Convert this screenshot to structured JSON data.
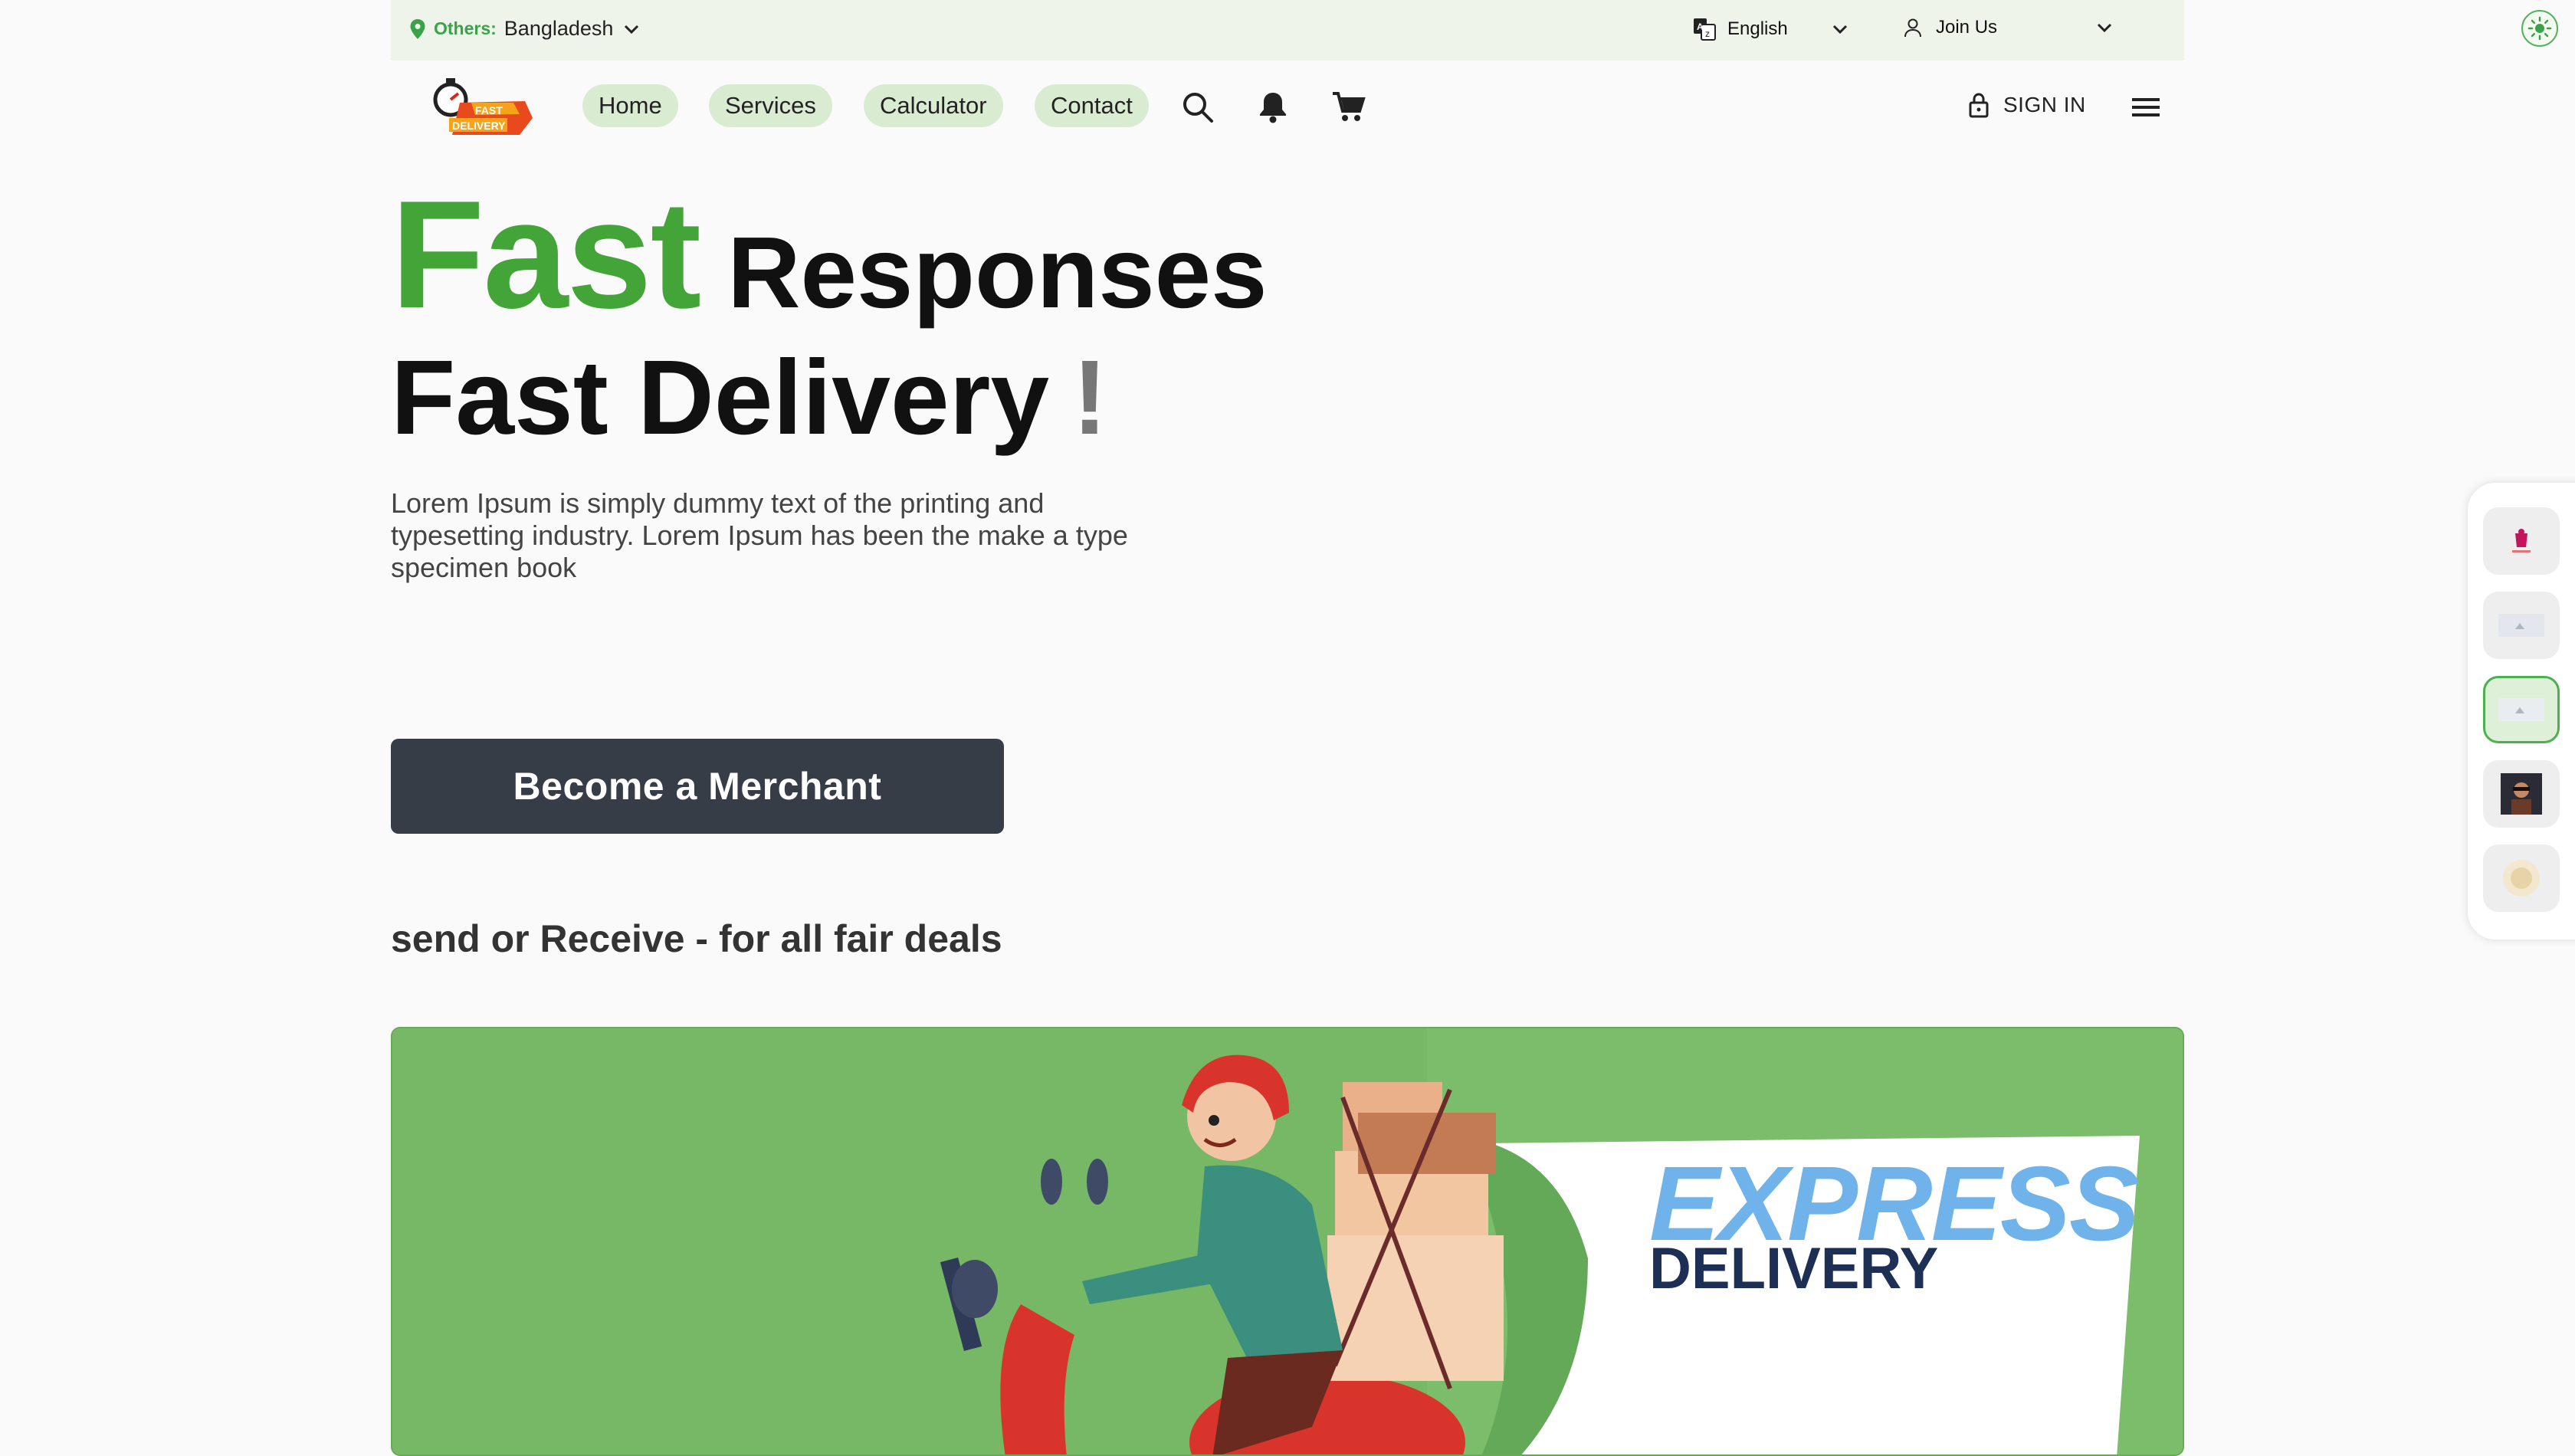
{
  "topbar": {
    "location_label": "Others:",
    "location_value": "Bangladesh",
    "language": "English",
    "join_label": "Join Us"
  },
  "nav": {
    "logo_text_top": "FAST",
    "logo_text_bottom": "DELIVERY",
    "links": [
      "Home",
      "Services",
      "Calculator",
      "Contact"
    ],
    "signin_label": "SIGN IN"
  },
  "hero": {
    "word_fast": "Fast",
    "word_responses": "Responses",
    "line2": "Fast Delivery",
    "exclaim": "!",
    "description": "Lorem Ipsum is simply dummy text of the printing and typesetting industry. Lorem Ipsum has been the make a type specimen book",
    "cta_label": "Become a Merchant",
    "tagline": "send or Receive - for all fair deals"
  },
  "banner": {
    "title": "EXPRESS",
    "subtitle": "DELIVERY"
  },
  "colors": {
    "accent_green": "#43a438",
    "pill_bg": "#d9ecd2",
    "cta_bg": "#373d47",
    "banner_bg": "#76b866",
    "express_blue": "#6fb3ea",
    "delivery_navy": "#1e2f56"
  },
  "icons": [
    "location-pin-icon",
    "chevron-down-icon",
    "translate-icon",
    "user-icon",
    "sun-icon",
    "search-icon",
    "bell-icon",
    "cart-icon",
    "lock-icon",
    "menu-icon"
  ]
}
